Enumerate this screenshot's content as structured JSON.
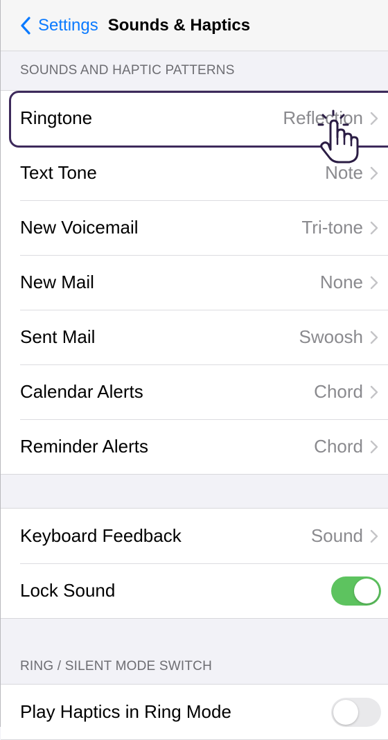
{
  "nav": {
    "back_label": "Settings",
    "title": "Sounds & Haptics"
  },
  "sections": {
    "patterns_header": "SOUNDS AND HAPTIC PATTERNS",
    "ring_silent_header": "RING / SILENT MODE SWITCH"
  },
  "patterns": [
    {
      "label": "Ringtone",
      "value": "Reflection"
    },
    {
      "label": "Text Tone",
      "value": "Note"
    },
    {
      "label": "New Voicemail",
      "value": "Tri-tone"
    },
    {
      "label": "New Mail",
      "value": "None"
    },
    {
      "label": "Sent Mail",
      "value": "Swoosh"
    },
    {
      "label": "Calendar Alerts",
      "value": "Chord"
    },
    {
      "label": "Reminder Alerts",
      "value": "Chord"
    }
  ],
  "feedback": {
    "keyboard_label": "Keyboard Feedback",
    "keyboard_value": "Sound",
    "lock_sound_label": "Lock Sound",
    "lock_sound_on": true
  },
  "ring_mode": {
    "label": "Play Haptics in Ring Mode",
    "on": false
  },
  "icons": {
    "back": "chevron-left-icon",
    "disclosure": "chevron-right-icon",
    "pointer": "hand-pointer-icon"
  },
  "colors": {
    "accent": "#0a7aff",
    "toggle_on": "#5dc35f",
    "highlight": "#3d2a5b"
  }
}
